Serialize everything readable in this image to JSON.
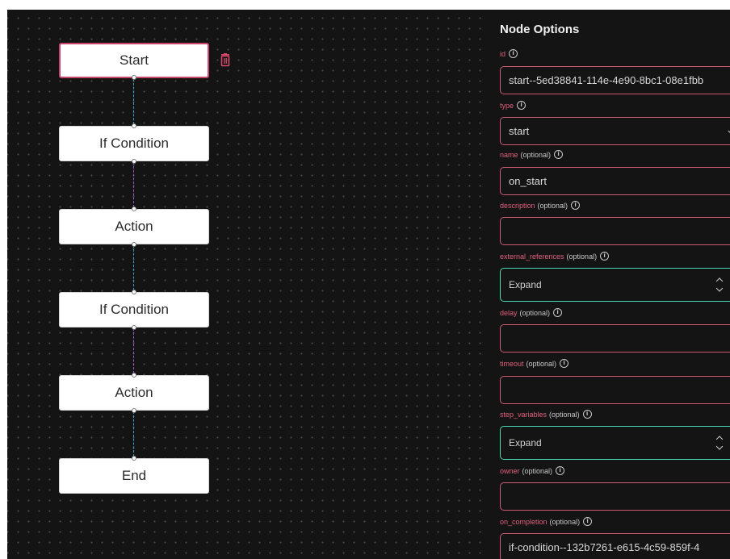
{
  "canvas": {
    "nodes": [
      {
        "label": "Start",
        "selected": true
      },
      {
        "label": "If Condition",
        "selected": false
      },
      {
        "label": "Action",
        "selected": false
      },
      {
        "label": "If Condition",
        "selected": false
      },
      {
        "label": "Action",
        "selected": false
      },
      {
        "label": "End",
        "selected": false
      }
    ],
    "delete_icon": "trash-icon"
  },
  "panel": {
    "title": "Node Options",
    "fields": {
      "id": {
        "label": "id",
        "optional": "",
        "value": "start--5ed38841-114e-4e90-8bc1-08e1fbb"
      },
      "type": {
        "label": "type",
        "optional": "",
        "value": "start"
      },
      "name": {
        "label": "name",
        "optional": "(optional)",
        "value": "on_start"
      },
      "description": {
        "label": "description",
        "optional": "(optional)",
        "value": ""
      },
      "external_references": {
        "label": "external_references",
        "optional": "(optional)",
        "value": "Expand"
      },
      "delay": {
        "label": "delay",
        "optional": "(optional)",
        "value": ""
      },
      "timeout": {
        "label": "timeout",
        "optional": "(optional)",
        "value": ""
      },
      "step_variables": {
        "label": "step_variables",
        "optional": "(optional)",
        "value": "Expand"
      },
      "owner": {
        "label": "owner",
        "optional": "(optional)",
        "value": ""
      },
      "on_completion": {
        "label": "on_completion",
        "optional": "(optional)",
        "value": "if-condition--132b7261-e615-4c59-859f-4"
      }
    },
    "info_icon": "info-icon"
  },
  "colors": {
    "background": "#141414",
    "field_border": "#cf5a76",
    "expand_border": "#4ad8b2",
    "label_color": "#e0607e",
    "edge_blue": "#3aa7c9",
    "edge_purple": "#9b5cc9"
  }
}
